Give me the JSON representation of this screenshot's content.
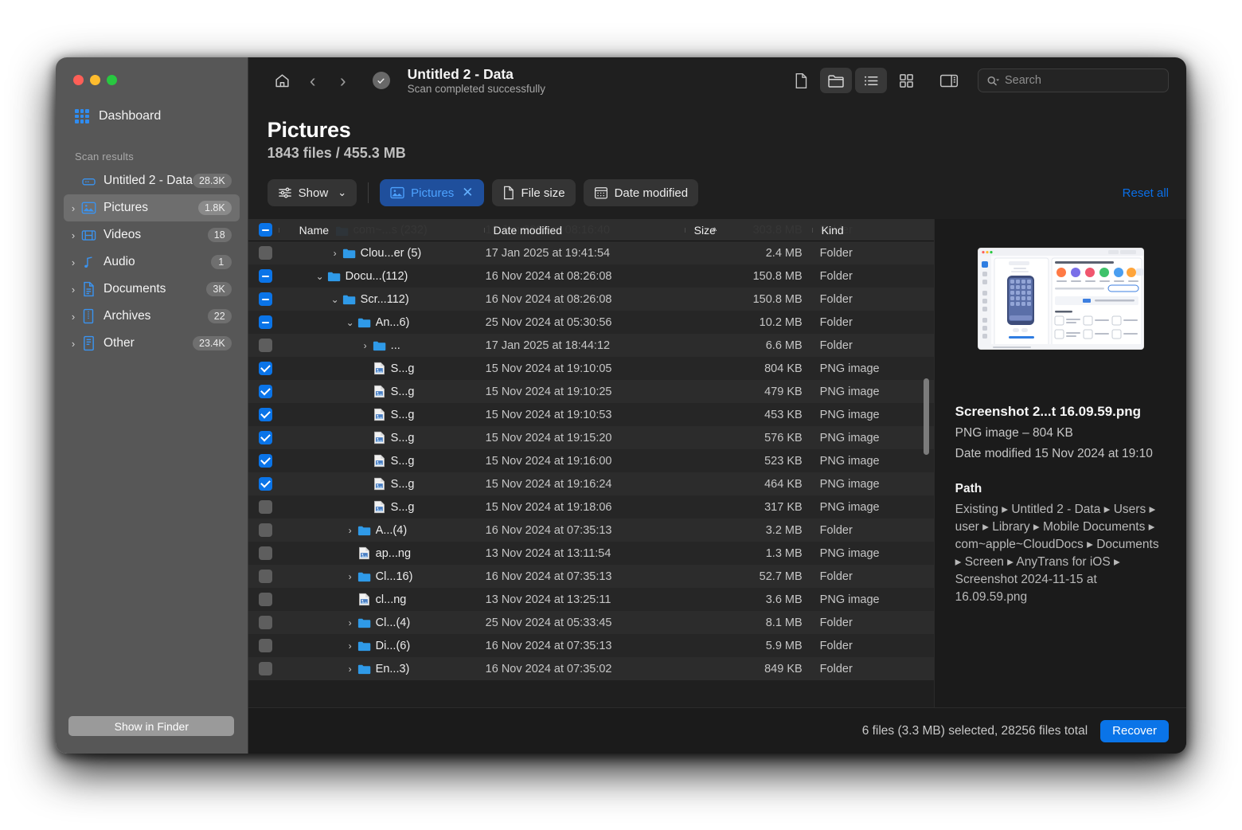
{
  "window": {
    "traffic_lights": [
      "close",
      "minimize",
      "zoom"
    ]
  },
  "sidebar": {
    "dashboard_label": "Dashboard",
    "section_label": "Scan results",
    "items": [
      {
        "label": "Untitled 2 - Data",
        "count": "28.3K",
        "icon": "drive-icon",
        "expandable": false,
        "active": false
      },
      {
        "label": "Pictures",
        "count": "1.8K",
        "icon": "pictures-icon",
        "expandable": true,
        "active": true
      },
      {
        "label": "Videos",
        "count": "18",
        "icon": "video-icon",
        "expandable": true,
        "active": false
      },
      {
        "label": "Audio",
        "count": "1",
        "icon": "audio-icon",
        "expandable": true,
        "active": false
      },
      {
        "label": "Documents",
        "count": "3K",
        "icon": "document-icon",
        "expandable": true,
        "active": false
      },
      {
        "label": "Archives",
        "count": "22",
        "icon": "archive-icon",
        "expandable": true,
        "active": false
      },
      {
        "label": "Other",
        "count": "23.4K",
        "icon": "other-icon",
        "expandable": true,
        "active": false
      }
    ],
    "show_in_finder_label": "Show in Finder"
  },
  "toolbar": {
    "home_icon": "home-icon",
    "back_icon": "chevron-left-icon",
    "forward_icon": "chevron-right-icon",
    "status_icon": "check-circle-icon",
    "title": "Untitled 2 - Data",
    "subtitle": "Scan completed successfully",
    "view_buttons": [
      {
        "name": "file-view-icon",
        "active": false
      },
      {
        "name": "folder-view-icon",
        "active": true
      },
      {
        "name": "list-view-icon",
        "active": true
      },
      {
        "name": "grid-view-icon",
        "active": false
      },
      {
        "name": "sidebar-toggle-icon",
        "active": false
      }
    ],
    "search_placeholder": "Search"
  },
  "page": {
    "title": "Pictures",
    "subtitle": "1843 files / 455.3 MB"
  },
  "filters": {
    "show_label": "Show",
    "chips": [
      {
        "label": "Pictures",
        "icon": "pictures-icon",
        "active": true,
        "removable": true
      },
      {
        "label": "File size",
        "icon": "document-icon",
        "active": false,
        "removable": false
      },
      {
        "label": "Date modified",
        "icon": "calendar-icon",
        "active": false,
        "removable": false
      }
    ],
    "reset_label": "Reset all"
  },
  "table": {
    "columns": [
      "Name",
      "Date modified",
      "Size",
      "Kind"
    ],
    "header_checkbox": "mid",
    "sort_indicator": "ascending",
    "scrolled_row": {
      "name": "com~...s (232)",
      "date": "16 Jan 2025 at 08:16:40",
      "size": "303.8 MB",
      "kind": "Folder",
      "indent": 3,
      "chev": "down"
    },
    "rows": [
      {
        "cb": "off",
        "indent": 3,
        "chev": "right",
        "icon": "folder-icon",
        "name": "Clou...er (5)",
        "date": "17 Jan 2025 at 19:41:54",
        "size": "2.4 MB",
        "kind": "Folder"
      },
      {
        "cb": "mid",
        "indent": 2,
        "chev": "down",
        "icon": "folder-icon",
        "name": "Docu...(112)",
        "date": "16 Nov 2024 at 08:26:08",
        "size": "150.8 MB",
        "kind": "Folder"
      },
      {
        "cb": "mid",
        "indent": 3,
        "chev": "down",
        "icon": "folder-icon",
        "name": "Scr...112)",
        "date": "16 Nov 2024 at 08:26:08",
        "size": "150.8 MB",
        "kind": "Folder"
      },
      {
        "cb": "mid",
        "indent": 4,
        "chev": "down",
        "icon": "folder-icon",
        "name": "An...6)",
        "date": "25 Nov 2024 at 05:30:56",
        "size": "10.2 MB",
        "kind": "Folder"
      },
      {
        "cb": "off",
        "indent": 5,
        "chev": "right",
        "icon": "folder-icon",
        "name": "...",
        "date": "17 Jan 2025 at 18:44:12",
        "size": "6.6 MB",
        "kind": "Folder"
      },
      {
        "cb": "on",
        "indent": 5,
        "chev": "none",
        "icon": "png-icon",
        "name": "S...g",
        "date": "15 Nov 2024 at 19:10:05",
        "size": "804 KB",
        "kind": "PNG image"
      },
      {
        "cb": "on",
        "indent": 5,
        "chev": "none",
        "icon": "png-icon",
        "name": "S...g",
        "date": "15 Nov 2024 at 19:10:25",
        "size": "479 KB",
        "kind": "PNG image"
      },
      {
        "cb": "on",
        "indent": 5,
        "chev": "none",
        "icon": "png-icon",
        "name": "S...g",
        "date": "15 Nov 2024 at 19:10:53",
        "size": "453 KB",
        "kind": "PNG image"
      },
      {
        "cb": "on",
        "indent": 5,
        "chev": "none",
        "icon": "png-icon",
        "name": "S...g",
        "date": "15 Nov 2024 at 19:15:20",
        "size": "576 KB",
        "kind": "PNG image"
      },
      {
        "cb": "on",
        "indent": 5,
        "chev": "none",
        "icon": "png-icon",
        "name": "S...g",
        "date": "15 Nov 2024 at 19:16:00",
        "size": "523 KB",
        "kind": "PNG image"
      },
      {
        "cb": "on",
        "indent": 5,
        "chev": "none",
        "icon": "png-icon",
        "name": "S...g",
        "date": "15 Nov 2024 at 19:16:24",
        "size": "464 KB",
        "kind": "PNG image"
      },
      {
        "cb": "off",
        "indent": 5,
        "chev": "none",
        "icon": "png-icon",
        "name": "S...g",
        "date": "15 Nov 2024 at 19:18:06",
        "size": "317 KB",
        "kind": "PNG image"
      },
      {
        "cb": "off",
        "indent": 4,
        "chev": "right",
        "icon": "folder-icon",
        "name": "A...(4)",
        "date": "16 Nov 2024 at 07:35:13",
        "size": "3.2 MB",
        "kind": "Folder"
      },
      {
        "cb": "off",
        "indent": 4,
        "chev": "none",
        "icon": "png-icon",
        "name": "ap...ng",
        "date": "13 Nov 2024 at 13:11:54",
        "size": "1.3 MB",
        "kind": "PNG image"
      },
      {
        "cb": "off",
        "indent": 4,
        "chev": "right",
        "icon": "folder-icon",
        "name": "Cl...16)",
        "date": "16 Nov 2024 at 07:35:13",
        "size": "52.7 MB",
        "kind": "Folder"
      },
      {
        "cb": "off",
        "indent": 4,
        "chev": "none",
        "icon": "png-icon",
        "name": "cl...ng",
        "date": "13 Nov 2024 at 13:25:11",
        "size": "3.6 MB",
        "kind": "PNG image"
      },
      {
        "cb": "off",
        "indent": 4,
        "chev": "right",
        "icon": "folder-icon",
        "name": "Cl...(4)",
        "date": "25 Nov 2024 at 05:33:45",
        "size": "8.1 MB",
        "kind": "Folder"
      },
      {
        "cb": "off",
        "indent": 4,
        "chev": "right",
        "icon": "folder-icon",
        "name": "Di...(6)",
        "date": "16 Nov 2024 at 07:35:13",
        "size": "5.9 MB",
        "kind": "Folder"
      },
      {
        "cb": "off",
        "indent": 4,
        "chev": "right",
        "icon": "folder-icon",
        "name": "En...3)",
        "date": "16 Nov 2024 at 07:35:02",
        "size": "849 KB",
        "kind": "Folder"
      }
    ]
  },
  "details": {
    "thumbnail_alt": "AnyTrans for iOS app screenshot preview",
    "file_name": "Screenshot 2...t 16.09.59.png",
    "kind_and_size": "PNG image – 804 KB",
    "date_modified": "Date modified 15 Nov 2024 at 19:10",
    "path_heading": "Path",
    "path": "Existing ▸ Untitled 2 - Data ▸ Users ▸ user ▸ Library ▸ Mobile Documents ▸ com~apple~CloudDocs ▸ Documents ▸ Screen ▸ AnyTrans for iOS ▸ Screenshot 2024-11-15 at 16.09.59.png"
  },
  "statusbar": {
    "status_text": "6 files (3.3 MB) selected, 28256 files total",
    "recover_label": "Recover"
  },
  "colors": {
    "accent_blue": "#0a74e8",
    "link_blue": "#0a6fe8",
    "chip_blue_bg": "#1f4f9c",
    "chip_blue_fg": "#4da2ff",
    "sidebar_bg": "#575757",
    "main_bg": "#1f1f1f",
    "details_bg": "#1b1b1b"
  }
}
